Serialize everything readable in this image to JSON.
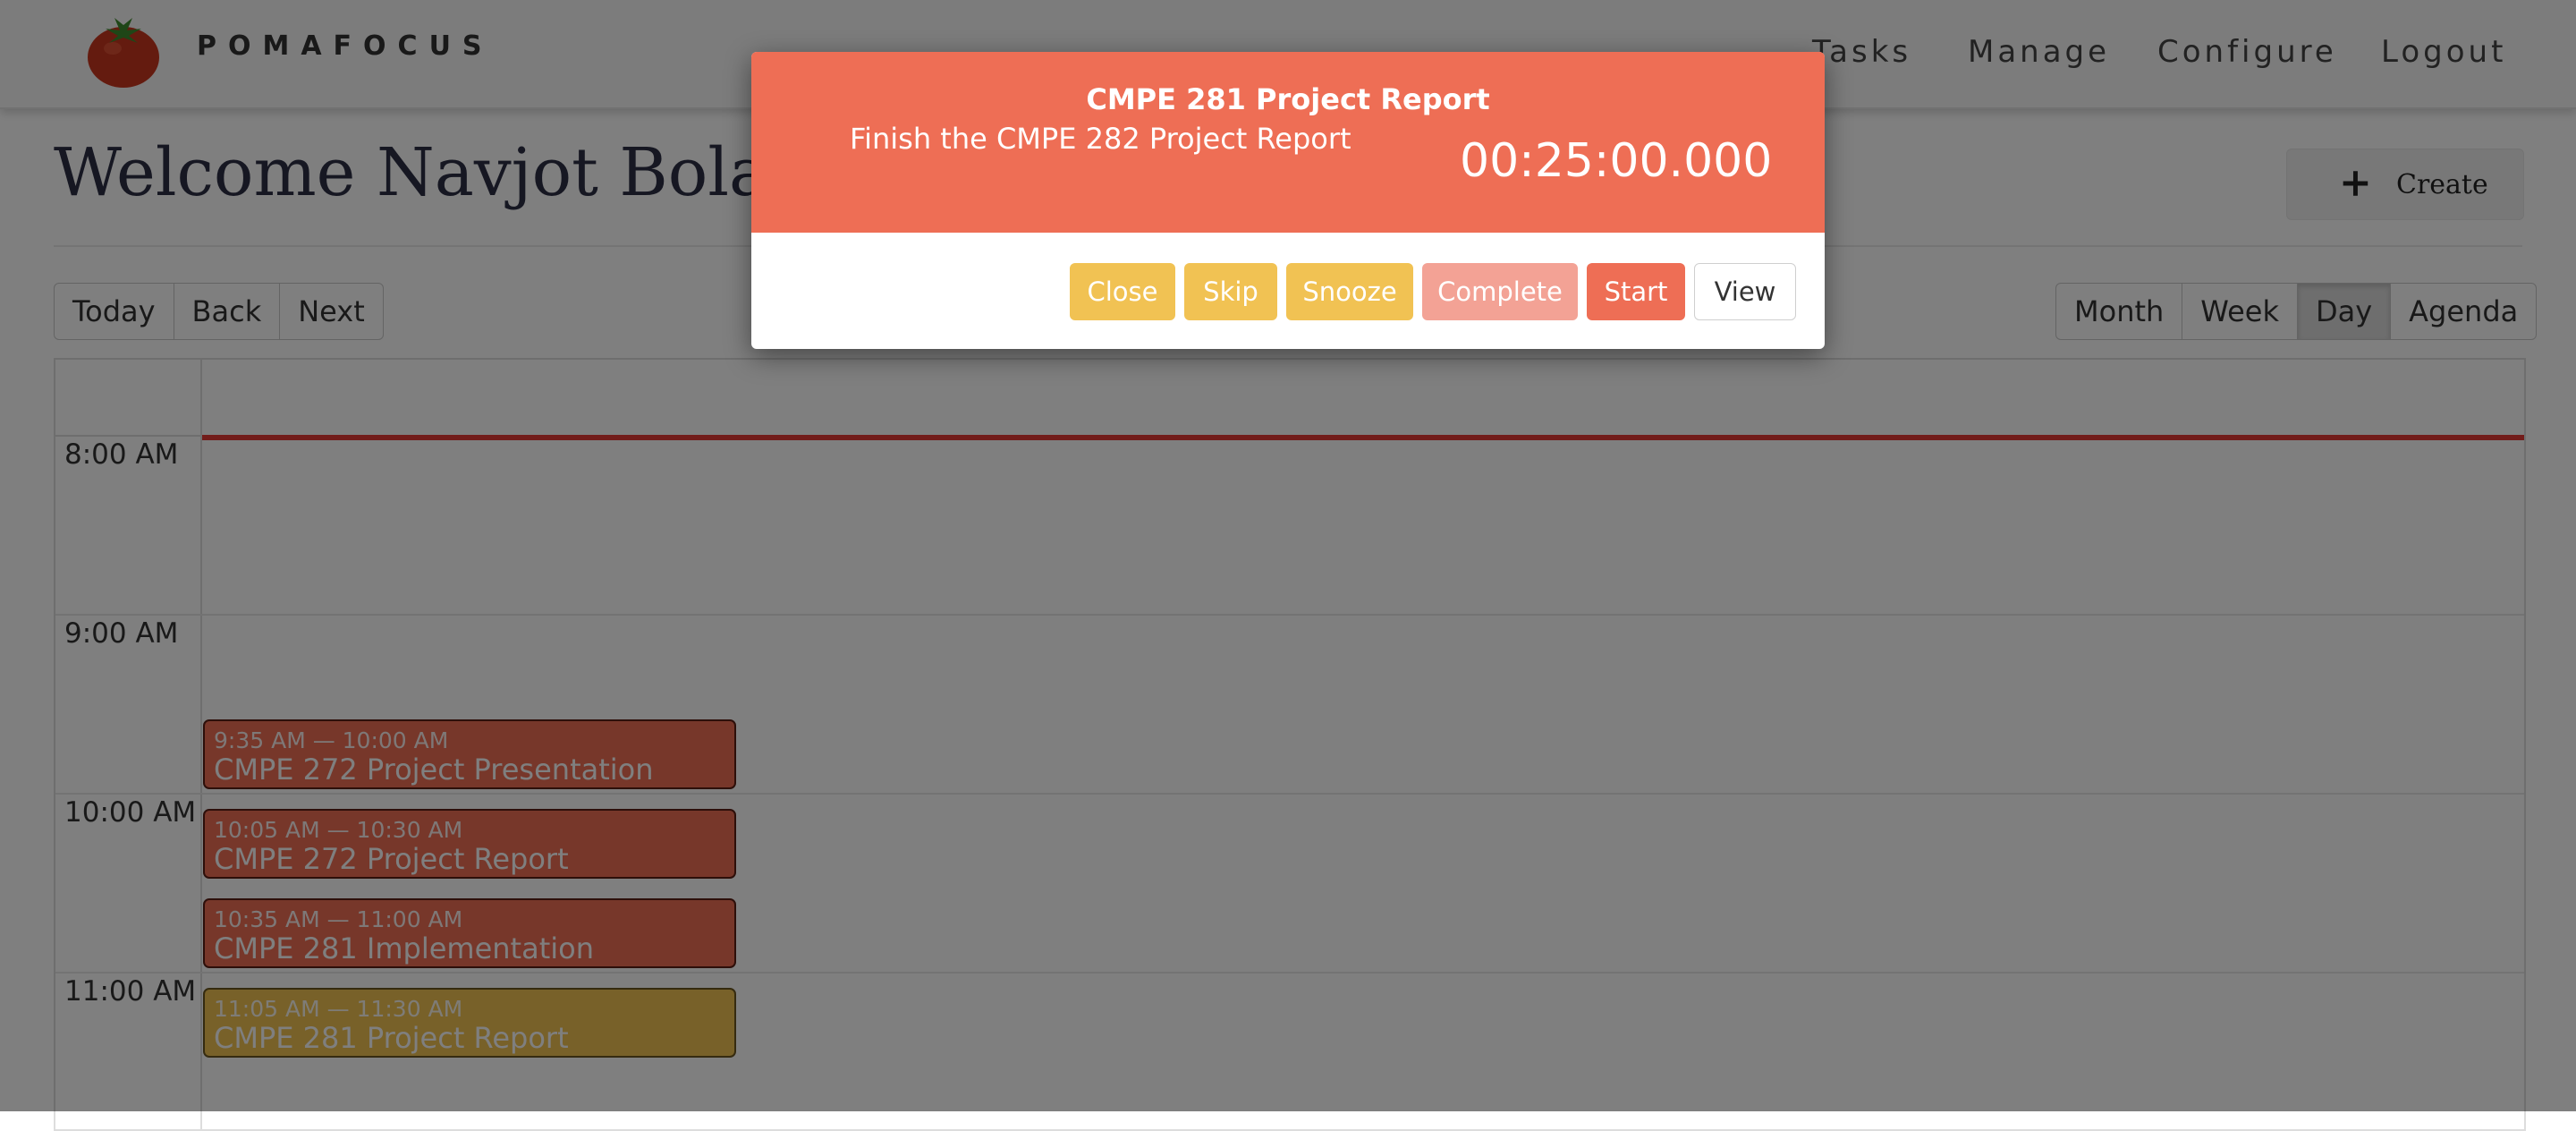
{
  "nav": {
    "brand": "POMAFOCUS",
    "links": [
      "Tasks",
      "Manage",
      "Configure",
      "Logout"
    ]
  },
  "header": {
    "title": "Welcome Navjot Bola",
    "create_label": "Create"
  },
  "toolbar": {
    "nav_buttons": [
      "Today",
      "Back",
      "Next"
    ],
    "view_buttons": [
      "Month",
      "Week",
      "Day",
      "Agenda"
    ],
    "active_view": "Day"
  },
  "calendar": {
    "hours": [
      "8:00 AM",
      "9:00 AM",
      "10:00 AM",
      "11:00 AM"
    ],
    "events": [
      {
        "time": "9:35 AM — 10:00 AM",
        "title": "CMPE 272 Project Presentation",
        "color": "#ee6e55"
      },
      {
        "time": "10:05 AM — 10:30 AM",
        "title": "CMPE 272 Project Report",
        "color": "#ee6e55"
      },
      {
        "time": "10:35 AM — 11:00 AM",
        "title": "CMPE 281 Implementation",
        "color": "#ee6e55"
      },
      {
        "time": "11:05 AM — 11:30 AM",
        "title": "CMPE 281 Project Report",
        "color": "#f1c253"
      }
    ]
  },
  "modal": {
    "title": "CMPE 281 Project Report",
    "description": "Finish the CMPE 282 Project Report",
    "timer": "00:25:00.000",
    "buttons": {
      "close": "Close",
      "skip": "Skip",
      "snooze": "Snooze",
      "complete": "Complete",
      "start": "Start",
      "view": "View"
    }
  },
  "colors": {
    "accent": "#ee6e55",
    "warning": "#f1c253",
    "now_line": "#e53935"
  },
  "icons": {
    "logo": "tomato-icon",
    "create": "plus-icon"
  }
}
